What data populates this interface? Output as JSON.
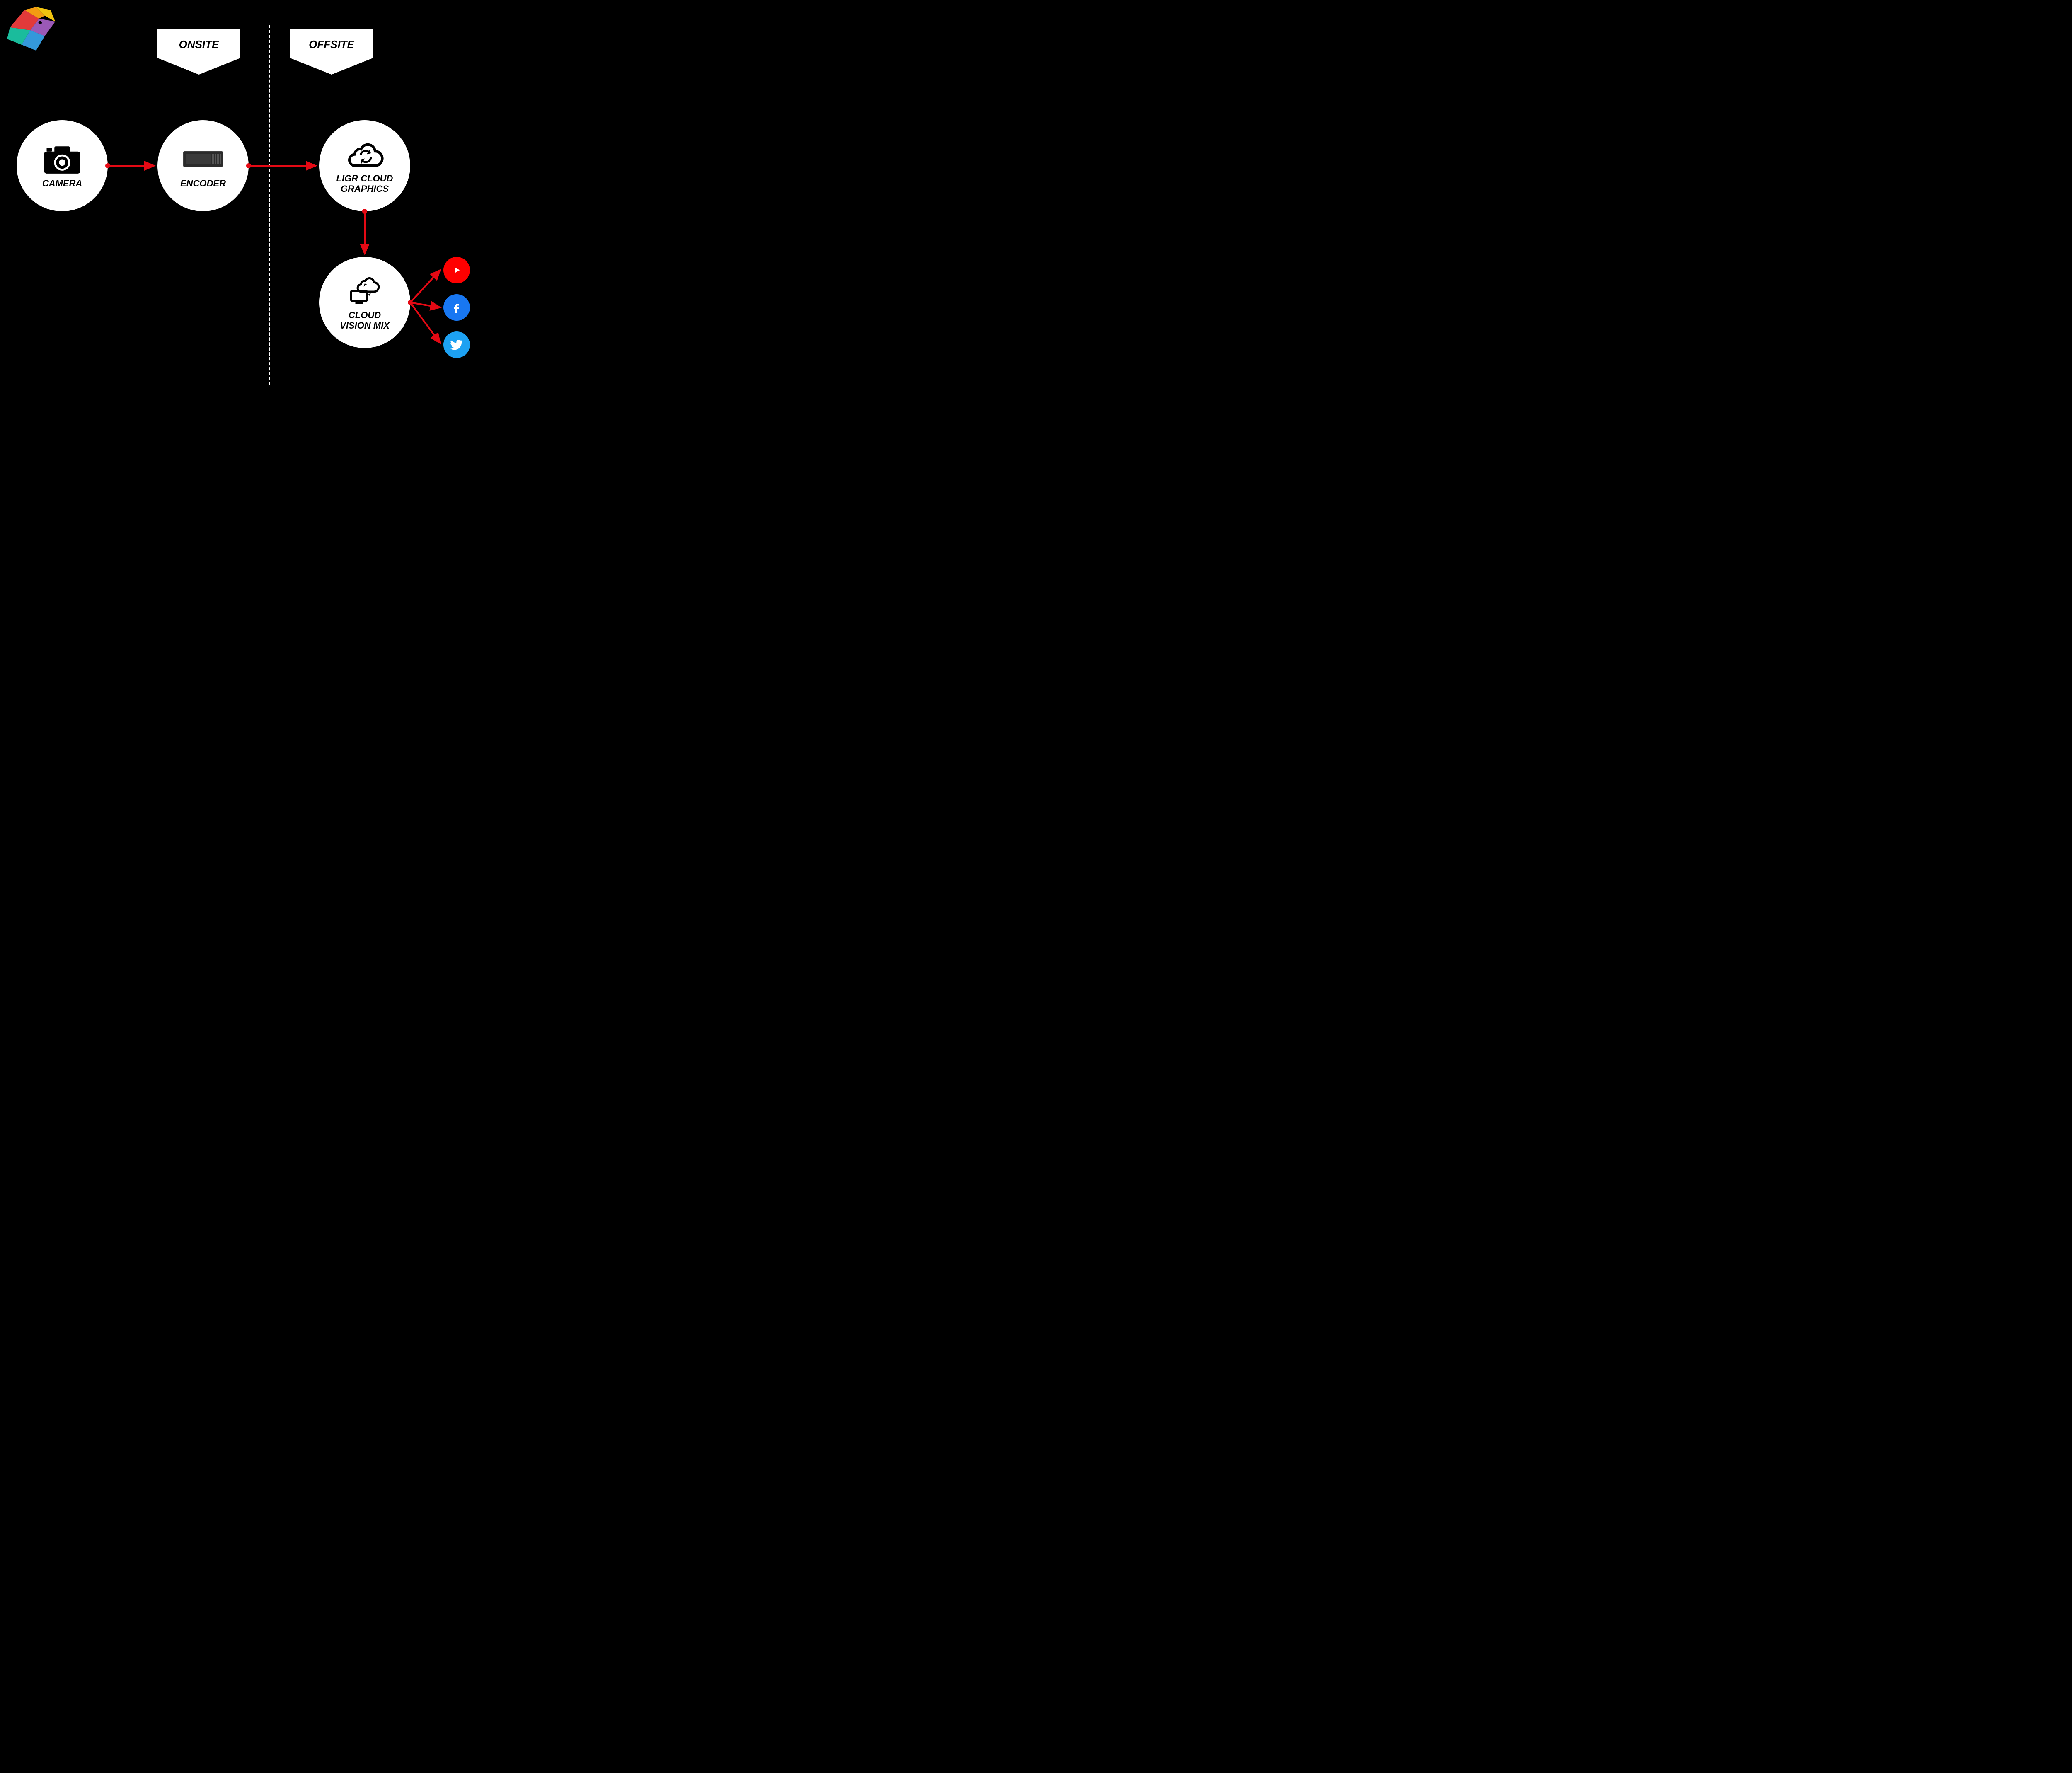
{
  "sections": {
    "onsite": "ONSITE",
    "offsite": "OFFSITE"
  },
  "nodes": {
    "camera": "CAMERA",
    "encoder": "ENCODER",
    "ligr": "LIGR CLOUD\nGRAPHICS",
    "cloudvm": "CLOUD\nVISION MIX"
  },
  "colors": {
    "arrow": "#E50914",
    "youtube": "#FF0000",
    "facebook": "#1877F2",
    "twitter": "#1DA1F2"
  }
}
